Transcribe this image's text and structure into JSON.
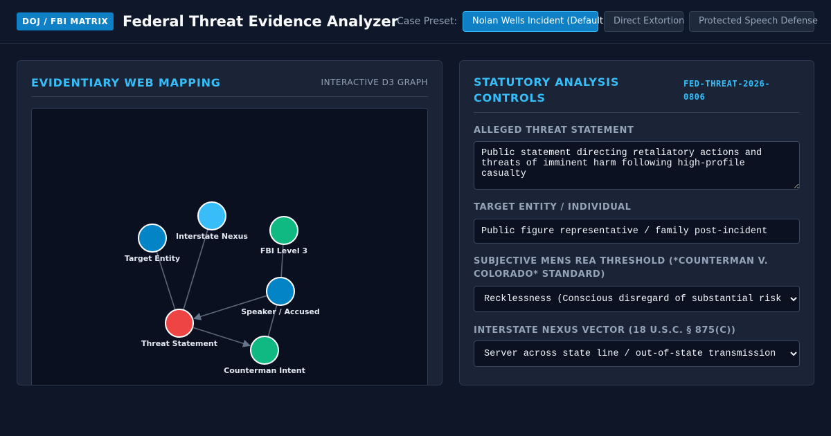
{
  "header": {
    "badge": "DOJ / FBI MATRIX",
    "title": "Federal Threat Evidence Analyzer",
    "preset_label": "Case Preset:",
    "presets": [
      {
        "label": "Nolan Wells Incident (Default)",
        "active": true
      },
      {
        "label": "Direct Extortion",
        "active": false
      },
      {
        "label": "Protected Speech Defense",
        "active": false
      }
    ]
  },
  "graph_panel": {
    "title": "EVIDENTIARY WEB MAPPING",
    "subtitle": "INTERACTIVE D3 GRAPH",
    "nodes": [
      {
        "id": "interstate",
        "label": "Interstate Nexus",
        "color": "#38bdf8"
      },
      {
        "id": "target",
        "label": "Target Entity",
        "color": "#0284c7"
      },
      {
        "id": "fbi",
        "label": "FBI Level 3",
        "color": "#10b981"
      },
      {
        "id": "speaker",
        "label": "Speaker / Accused",
        "color": "#0284c7"
      },
      {
        "id": "threat",
        "label": "Threat Statement",
        "color": "#ef4444"
      },
      {
        "id": "intent",
        "label": "Counterman Intent",
        "color": "#10b981"
      }
    ],
    "links": [
      {
        "source": "target",
        "target": "threat",
        "arrow": false
      },
      {
        "source": "interstate",
        "target": "threat",
        "arrow": false
      },
      {
        "source": "speaker",
        "target": "threat",
        "arrow": true
      },
      {
        "source": "threat",
        "target": "intent",
        "arrow": true
      },
      {
        "source": "fbi",
        "target": "speaker",
        "arrow": false
      },
      {
        "source": "speaker",
        "target": "intent",
        "arrow": false
      }
    ]
  },
  "controls": {
    "title": "STATUTORY ANALYSIS CONTROLS",
    "case_id": "FED-THREAT-2026-0806",
    "threat_label": "ALLEGED THREAT STATEMENT",
    "threat_value": "Public statement directing retaliatory actions and threats of imminent harm following high-profile casualty",
    "target_label": "TARGET ENTITY / INDIVIDUAL",
    "target_value": "Public figure representative / family post-incident",
    "mens_rea_label": "SUBJECTIVE MENS REA THRESHOLD (*COUNTERMAN V. COLORADO* STANDARD)",
    "mens_rea_value": "Recklessness (Conscious disregard of substantial risk)",
    "nexus_label": "INTERSTATE NEXUS VECTOR (18 U.S.C. § 875(C))",
    "nexus_value": "Server across state line / out-of-state transmission"
  }
}
